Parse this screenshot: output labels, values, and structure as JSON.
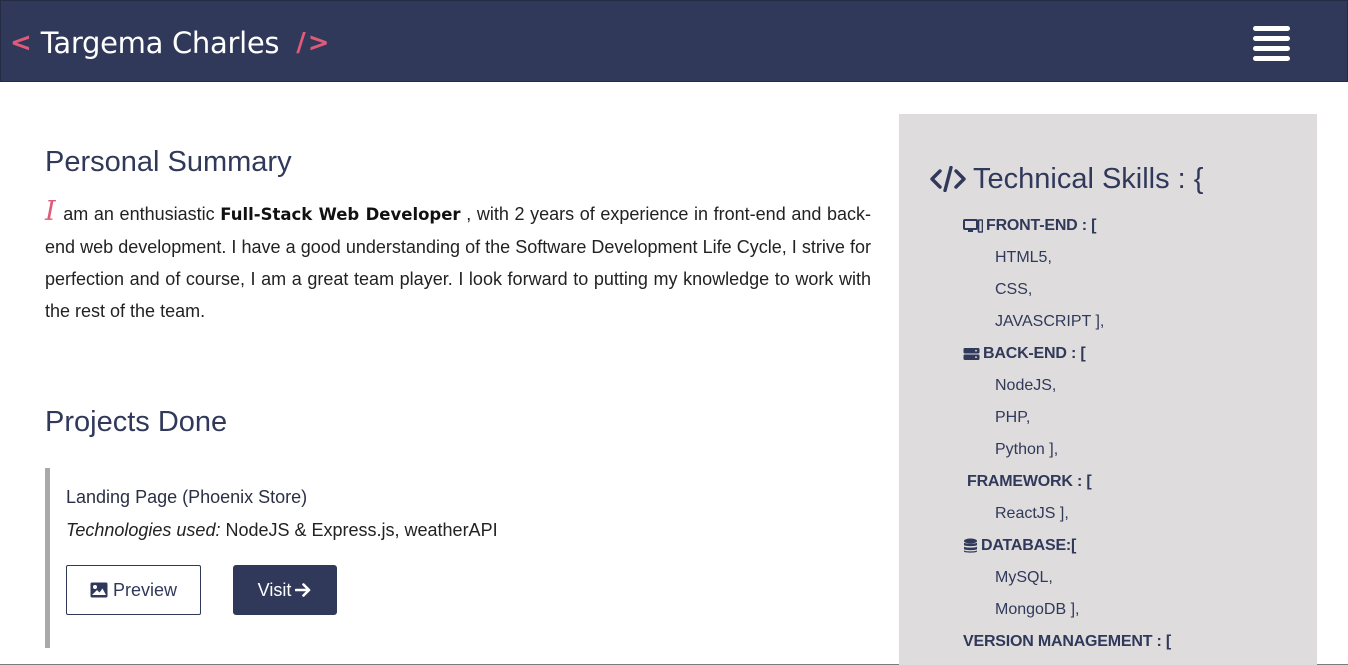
{
  "header": {
    "open_bracket": "<",
    "brand_name": "Targema Charles",
    "close_bracket": "/>"
  },
  "summary": {
    "title": "Personal Summary",
    "drop_cap": "I",
    "text_before": " am an enthusiastic ",
    "highlight": "Full-Stack Web Developer",
    "text_after": " , with 2 years of experience in front-end and back-end web development. I have a good understanding of the Software Development Life Cycle, I strive for perfection and of course, I am a great team player. I look forward to putting my knowledge to work with the rest of the team."
  },
  "projects": {
    "title": "Projects Done",
    "items": [
      {
        "name": "Landing Page (Phoenix Store)",
        "tech_label": "Technologies used:",
        "tech_value": " NodeJS & Express.js, weatherAPI",
        "preview_label": "Preview",
        "visit_label": "Visit"
      }
    ]
  },
  "skills": {
    "title": "Technical Skills : {",
    "lines": [
      {
        "kind": "cat",
        "icon": "desktop-icon",
        "text": "FRONT-END : ["
      },
      {
        "kind": "item",
        "text": "HTML5,"
      },
      {
        "kind": "item",
        "text": "CSS,"
      },
      {
        "kind": "item",
        "text": "JAVASCRIPT ],"
      },
      {
        "kind": "cat",
        "icon": "server-icon",
        "text": "BACK-END : ["
      },
      {
        "kind": "item",
        "text": "NodeJS,"
      },
      {
        "kind": "item",
        "text": "PHP,"
      },
      {
        "kind": "item",
        "text": "Python ],"
      },
      {
        "kind": "cat",
        "icon": "",
        "text": "FRAMEWORK : ["
      },
      {
        "kind": "item",
        "text": "ReactJS ],"
      },
      {
        "kind": "cat",
        "icon": "database-icon",
        "text": "DATABASE:["
      },
      {
        "kind": "item",
        "text": "MySQL,"
      },
      {
        "kind": "item",
        "text": "MongoDB ],"
      },
      {
        "kind": "cat",
        "icon": "",
        "text": "VERSION MANAGEMENT : ["
      }
    ]
  },
  "colors": {
    "navbar": "#31395a",
    "accent_pink": "#e05b79",
    "panel_gray": "#dedcdd",
    "text_navy": "#31395a"
  }
}
